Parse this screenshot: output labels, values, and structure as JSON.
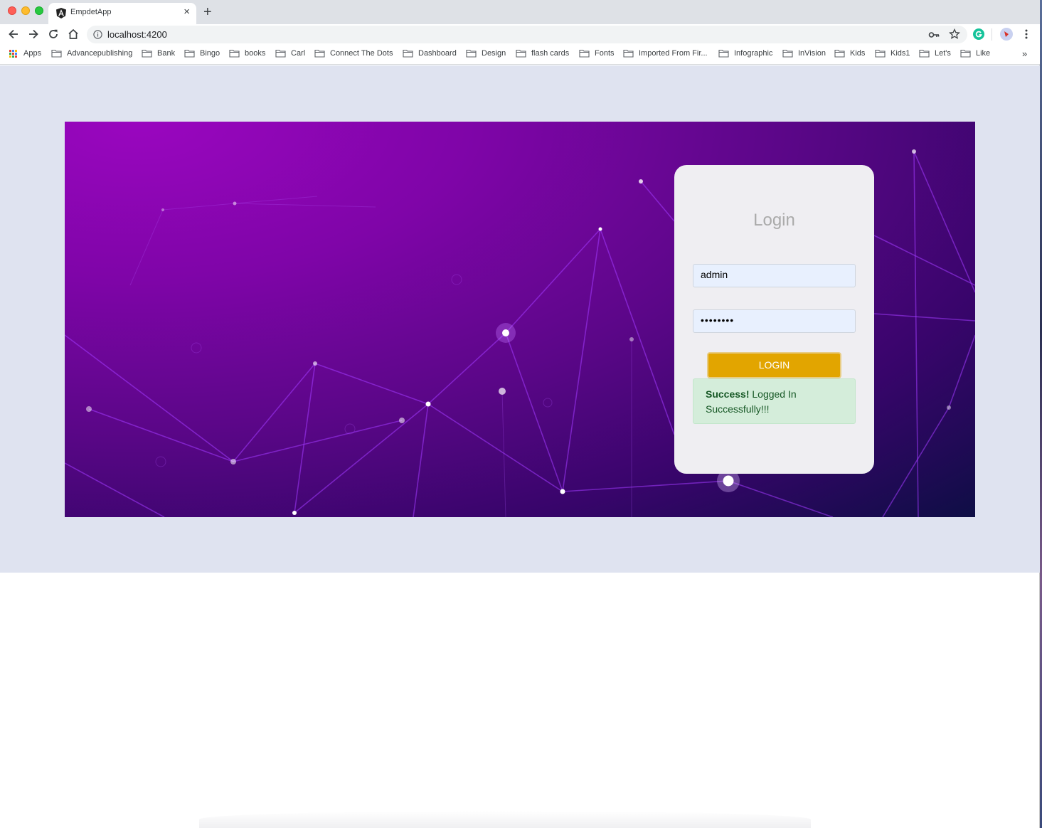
{
  "browser": {
    "tab_title": "EmpdetApp",
    "tab_close": "×",
    "new_tab": "+",
    "url": "localhost:4200",
    "more_bookmarks": "»",
    "bookmarks": [
      {
        "label": "Apps",
        "icon": "apps-grid-icon"
      },
      {
        "label": "Advancepublishing",
        "icon": "folder-icon"
      },
      {
        "label": "Bank",
        "icon": "folder-icon"
      },
      {
        "label": "Bingo",
        "icon": "folder-icon"
      },
      {
        "label": "books",
        "icon": "folder-icon"
      },
      {
        "label": "Carl",
        "icon": "folder-icon"
      },
      {
        "label": "Connect The Dots",
        "icon": "folder-icon"
      },
      {
        "label": "Dashboard",
        "icon": "folder-icon"
      },
      {
        "label": "Design",
        "icon": "folder-icon"
      },
      {
        "label": "flash cards",
        "icon": "folder-icon"
      },
      {
        "label": "Fonts",
        "icon": "folder-icon"
      },
      {
        "label": "Imported From Fir...",
        "icon": "folder-icon"
      },
      {
        "label": "Infographic",
        "icon": "folder-icon"
      },
      {
        "label": "InVision",
        "icon": "folder-icon"
      },
      {
        "label": "Kids",
        "icon": "folder-icon"
      },
      {
        "label": "Kids1",
        "icon": "folder-icon"
      },
      {
        "label": "Let's",
        "icon": "folder-icon"
      },
      {
        "label": "Like",
        "icon": "folder-icon"
      }
    ]
  },
  "login": {
    "title": "Login",
    "username_value": "admin",
    "password_value": "••••••••",
    "button_label": "LOGIN",
    "alert_strong": "Success!",
    "alert_text": " Logged In Successfully!!!"
  },
  "colors": {
    "page_bg": "#dfe3f0",
    "button": "#e2a500",
    "alert_bg": "#d4edda",
    "alert_text": "#155724",
    "hero_start": "#9a06bf",
    "hero_end": "#0e0e45"
  }
}
